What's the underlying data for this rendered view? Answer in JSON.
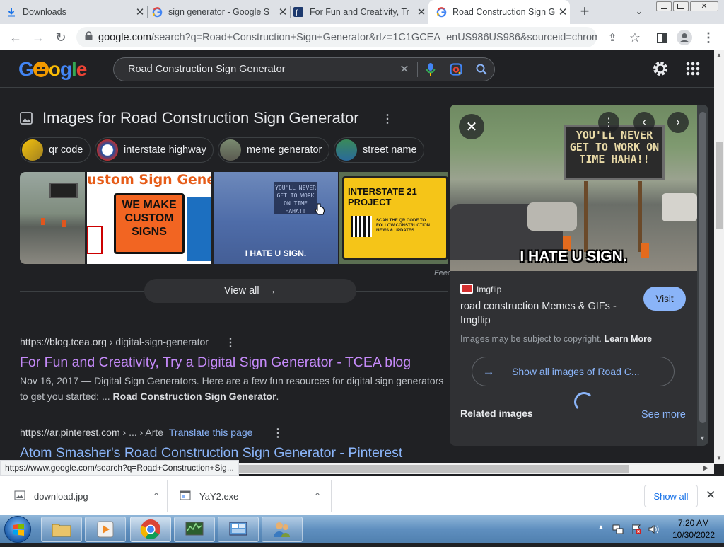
{
  "tabs": [
    {
      "label": "Downloads",
      "icon": "download-icon",
      "active": false
    },
    {
      "label": "sign generator - Google S",
      "icon": "google-icon",
      "active": false
    },
    {
      "label": "For Fun and Creativity, Tr",
      "icon": "tcea-icon",
      "active": false
    },
    {
      "label": "Road Construction Sign G",
      "icon": "google-icon",
      "active": true
    }
  ],
  "toolbar": {
    "url_domain": "google.com",
    "url_rest": "/search?q=Road+Construction+Sign+Generator&rlz=1C1GCEA_enUS986US986&sourceid=chrome..."
  },
  "google": {
    "logo": "Google",
    "query": "Road Construction Sign Generator"
  },
  "images_section": {
    "title": "Images for Road Construction Sign Generator",
    "chips": [
      "qr code",
      "interstate highway",
      "meme generator",
      "street name"
    ],
    "thumbs_text": [
      "ustom Sign Generat",
      "WE MAKE CUSTOM SIGNS",
      "YOU'LL NEVER GET TO WORK ON TIME HAHA!!",
      "I HATE U SIGN.",
      "INTERSTATE 21 PROJECT",
      "SCAN THE QR CODE TO FOLLOW CONSTRUCTION NEWS & UPDATES"
    ],
    "feedback": "Feed",
    "view_all": "View all"
  },
  "results": [
    {
      "cite_domain": "https://blog.tcea.org",
      "cite_path": " › digital-sign-generator",
      "title": "For Fun and Creativity, Try a Digital Sign Generator - TCEA blog",
      "snippet_date": "Nov 16, 2017 — ",
      "snippet": "Digital Sign Generators. Here are a few fun resources for digital sign generators to get you started: ... ",
      "snippet_bold": "Road Construction Sign Generator",
      "snippet_end": "."
    },
    {
      "cite_domain": "https://ar.pinterest.com",
      "cite_path": " › ... › Arte",
      "translate": "Translate this page",
      "title": "Atom Smasher's Road Construction Sign Generator - Pinterest"
    }
  ],
  "panel": {
    "meme_top": "YOU'LL NEVER GET TO WORK ON TIME HAHA!!",
    "meme_bottom": "I HATE U SIGN.",
    "source_name": "Imgflip",
    "title": "road construction Memes & GIFs - Imgflip",
    "copyright": "Images may be subject to copyright. ",
    "learn_more": "Learn More",
    "visit": "Visit",
    "show_all": "Show all images of Road C...",
    "related": "Related images",
    "see_more": "See more"
  },
  "status_url": "https://www.google.com/search?q=Road+Construction+Sig...",
  "downloads": {
    "items": [
      {
        "name": "download.jpg",
        "icon": "image-file-icon"
      },
      {
        "name": "YaY2.exe",
        "icon": "exe-file-icon"
      }
    ],
    "show_all": "Show all"
  },
  "taskbar": {
    "time": "7:20 AM",
    "date": "10/30/2022"
  }
}
